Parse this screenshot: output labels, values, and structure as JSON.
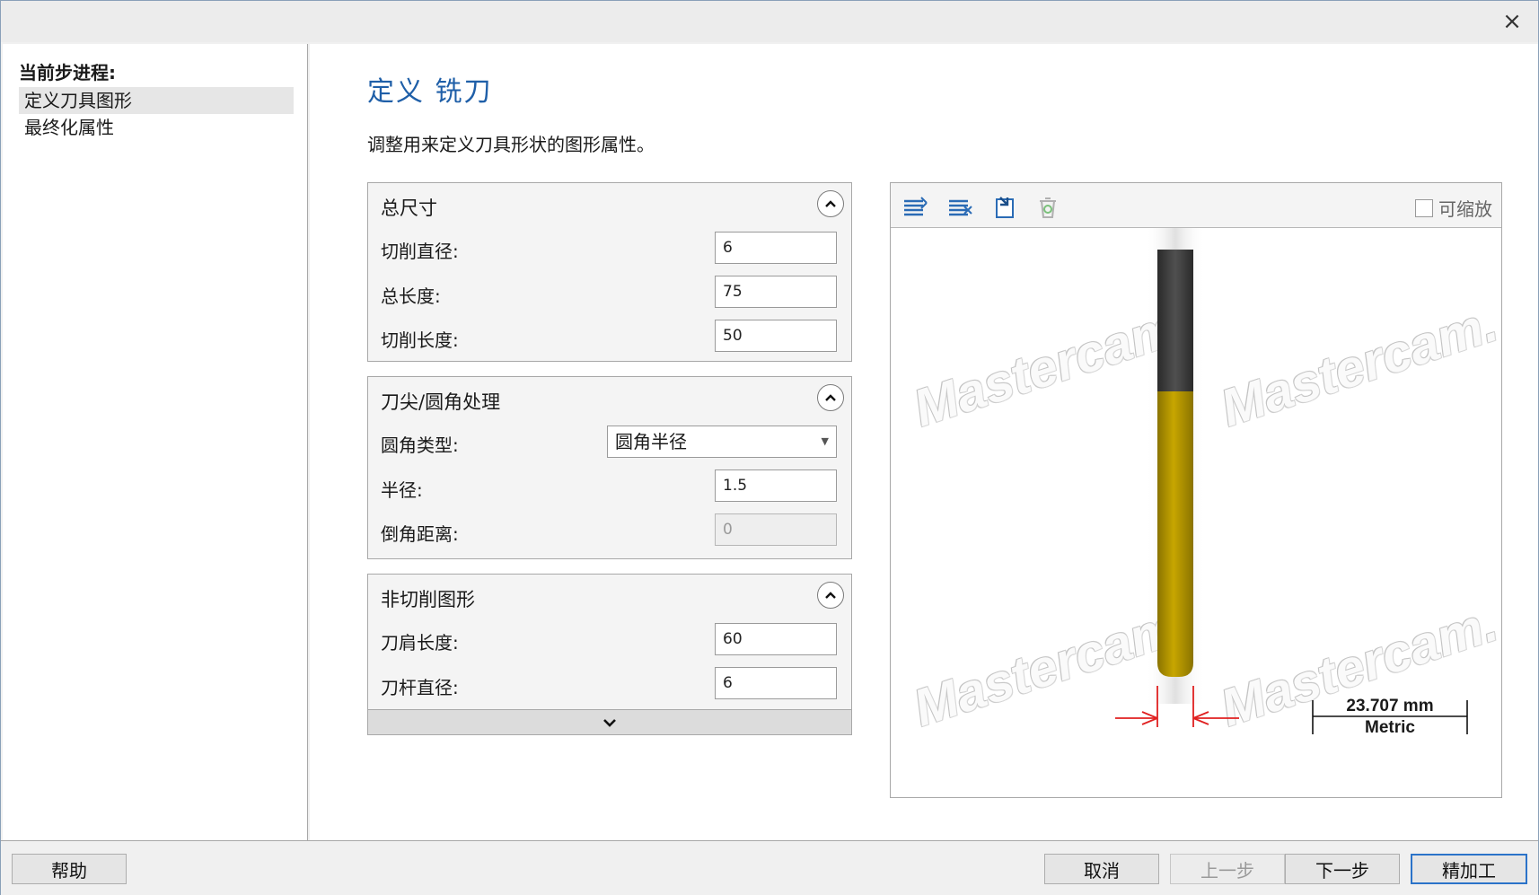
{
  "window": {
    "close_icon": "×"
  },
  "sidebar": {
    "heading": "当前步进程:",
    "steps": [
      {
        "label": "定义刀具图形",
        "active": true
      },
      {
        "label": "最终化属性",
        "active": false
      }
    ]
  },
  "main": {
    "title": "定义 铣刀",
    "description": "调整用来定义刀具形状的图形属性。"
  },
  "panels": {
    "overall": {
      "title": "总尺寸",
      "cut_diameter_label": "切削直径:",
      "cut_diameter_value": "6",
      "overall_length_label": "总长度:",
      "overall_length_value": "75",
      "cut_length_label": "切削长度:",
      "cut_length_value": "50"
    },
    "tip": {
      "title": "刀尖/圆角处理",
      "corner_type_label": "圆角类型:",
      "corner_type_value": "圆角半径",
      "radius_label": "半径:",
      "radius_value": "1.5",
      "chamfer_label": "倒角距离:",
      "chamfer_value": "0"
    },
    "noncut": {
      "title": "非切削图形",
      "shoulder_length_label": "刀肩长度:",
      "shoulder_length_value": "60",
      "shank_diameter_label": "刀杆直径:",
      "shank_diameter_value": "6"
    }
  },
  "preview": {
    "scalable_label": "可缩放",
    "scalable_checked": false,
    "watermark_text": "Mastercam.",
    "scale_value": "23.707 mm",
    "scale_unit": "Metric",
    "colors": {
      "shank": "#3c3c3c",
      "flute": "#b89a00",
      "dimension": "#e02020"
    },
    "icons": [
      "layers-add-icon",
      "layers-remove-icon",
      "import-icon",
      "recycle-icon"
    ]
  },
  "footer": {
    "help": "帮助",
    "cancel": "取消",
    "back": "上一步",
    "next": "下一步",
    "finish": "精加工"
  }
}
